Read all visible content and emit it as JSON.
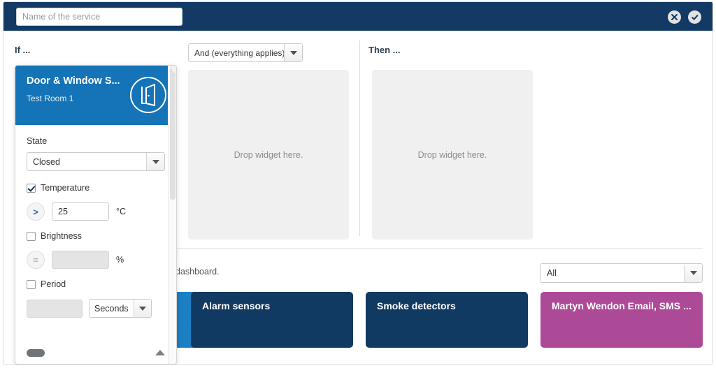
{
  "header": {
    "service_name_value": "",
    "service_name_placeholder": "Name of the service",
    "cancel_icon": "close-icon",
    "confirm_icon": "check-icon",
    "background_color": "#123a64"
  },
  "builder": {
    "if_label": "If ...",
    "then_label": "Then ...",
    "combine_mode": "And (everything applies)",
    "if_dropzone_text": "Drop widget here.",
    "then_dropzone_text": "Drop widget here."
  },
  "config_panel": {
    "card_title": "Door & Window S...",
    "card_subtitle": "Test Room 1",
    "card_color": "#1574b7",
    "device_icon": "door-icon",
    "delete_icon": "trash-icon",
    "state_label": "State",
    "state_value": "Closed",
    "temperature": {
      "label": "Temperature",
      "checked": true,
      "operator": ">",
      "value": "25",
      "unit": "°C"
    },
    "brightness": {
      "label": "Brightness",
      "checked": false,
      "operator": "=",
      "value": "",
      "unit": "%"
    },
    "period": {
      "label": "Period",
      "checked": false,
      "value": "",
      "unit_value": "Seconds"
    },
    "collapse_icon": "chevron-up-icon",
    "toggle_icon": "toggle-pill"
  },
  "dashboard": {
    "caption": "dashboard.",
    "filter_value": "All",
    "tiles": [
      {
        "label": "",
        "color": "#1b7fc4"
      },
      {
        "label": "Alarm sensors",
        "color": "#113a63"
      },
      {
        "label": "Smoke detectors",
        "color": "#113a63"
      },
      {
        "label": "Martyn Wendon Email, SMS ...",
        "color": "#ad4a98"
      }
    ]
  }
}
